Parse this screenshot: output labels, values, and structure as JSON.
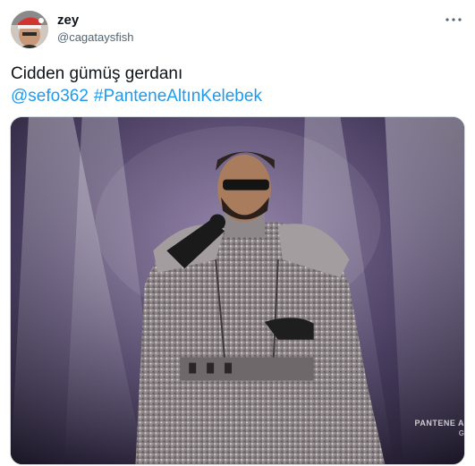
{
  "tweet": {
    "author_name": "zey",
    "author_handle": "@cagataysfish",
    "more_icon": "more-horizontal-icon",
    "text_line1": "Cidden gümüş gerdanı",
    "mention": "@sefo362",
    "hashtag": "#PanteneAltınKelebek",
    "media_watermark": "PANTENE A",
    "media_watermark2": "G",
    "colors": {
      "link": "#1d9bf0",
      "text": "#0f1419",
      "secondary": "#536471",
      "border": "#cfd9de"
    }
  }
}
